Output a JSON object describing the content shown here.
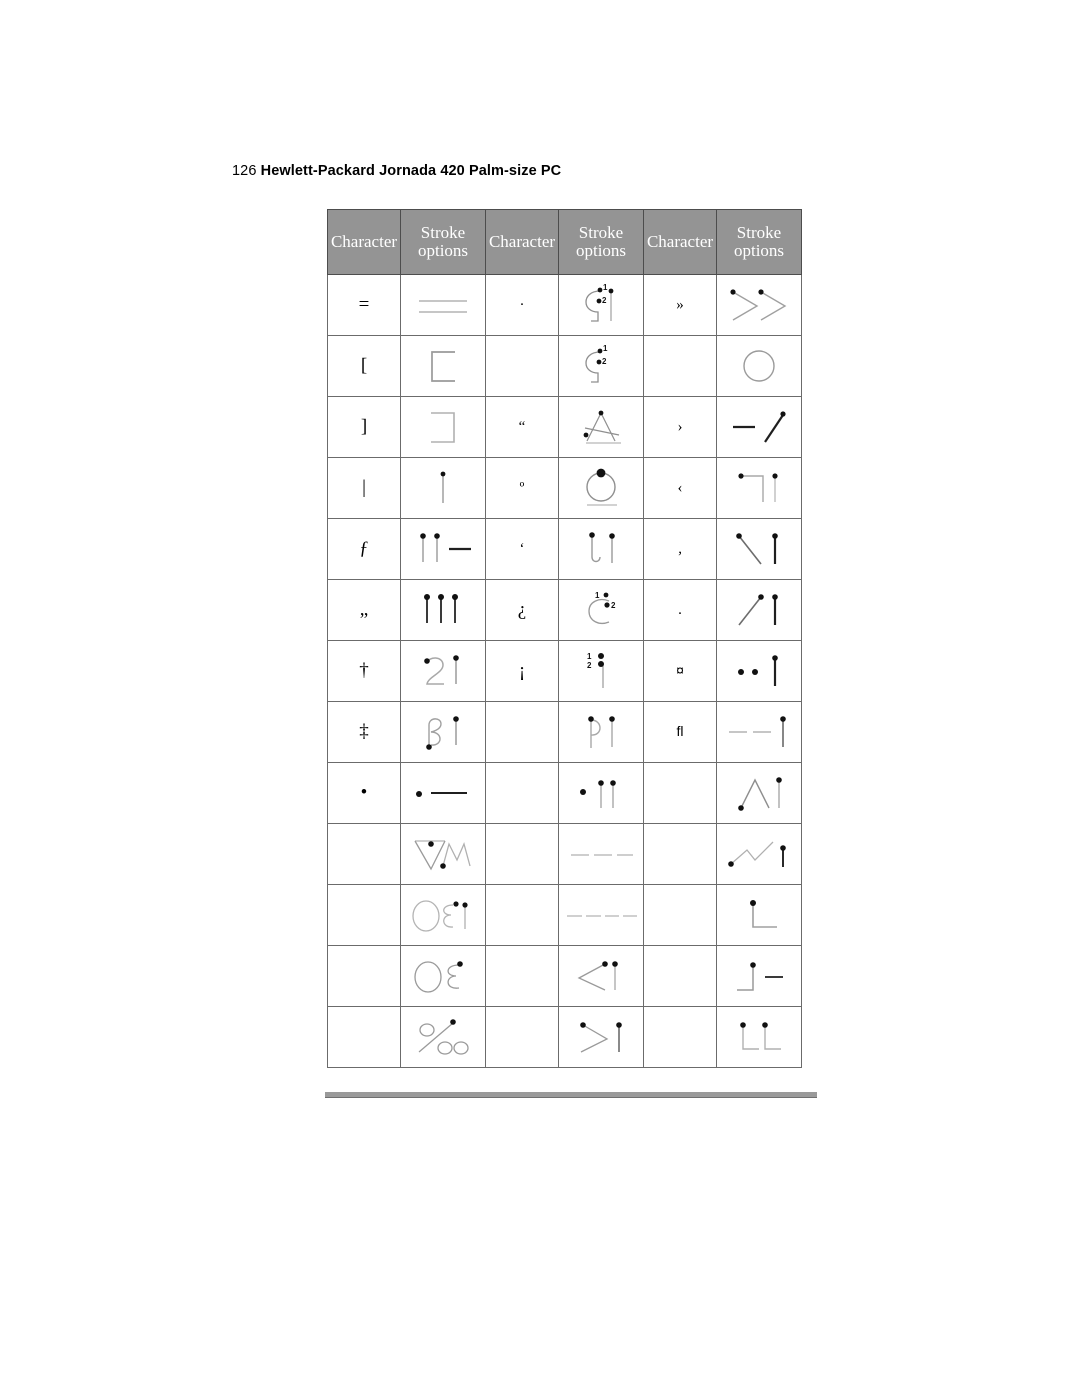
{
  "page": {
    "folio": "126",
    "title": "Hewlett-Packard Jornada 420 Palm-size PC"
  },
  "table": {
    "headers": {
      "character": "Character",
      "stroke_options": "Stroke options"
    },
    "header_cells": [
      "Character",
      "Stroke options",
      "Character",
      "Stroke options",
      "Character",
      "Stroke options"
    ],
    "rows": [
      {
        "c1": "=",
        "c2": "·",
        "c3": "»"
      },
      {
        "c1": "[",
        "c2": "",
        "c3": ""
      },
      {
        "c1": "]",
        "c2": "“",
        "c3": "›"
      },
      {
        "c1": "|",
        "c2": "º",
        "c3": "‹"
      },
      {
        "c1": "ƒ",
        "c2": "‘",
        "c3": "‚"
      },
      {
        "c1": "„",
        "c2": "¿",
        "c3": "."
      },
      {
        "c1": "†",
        "c2": "¡",
        "c3": "¤"
      },
      {
        "c1": "‡",
        "c2": "",
        "c3": "fl"
      },
      {
        "c1": "•",
        "c2": "",
        "c3": ""
      },
      {
        "c1": "",
        "c2": "",
        "c3": ""
      },
      {
        "c1": "",
        "c2": "",
        "c3": ""
      },
      {
        "c1": "",
        "c2": "",
        "c3": ""
      },
      {
        "c1": "",
        "c2": "",
        "c3": ""
      }
    ],
    "stroke_labels": {
      "r1c1": "two-horizontal-lines",
      "r1c2": "numbered-c-hook-and-bar",
      "r1c3": "double-chevron-right",
      "r2c1": "left-bracket-corner",
      "r2c2": "numbered-c-hook",
      "r2c3": "circle",
      "r3c1": "right-bracket-corner",
      "r3c2": "crossed-a",
      "r3c3": "dash-and-slash",
      "r4c1": "vertical-bar",
      "r4c2": "filled-dot-circle",
      "r4c3": "corner-and-bar",
      "r5c1": "two-bars-and-dash",
      "r5c2": "hook-and-bar",
      "r5c3": "backslash-and-bar",
      "r6c1": "three-bars",
      "r6c2": "numbered-reverse-c",
      "r6c3": "slash-and-bar",
      "r7c1": "digit-two-and-bar",
      "r7c2": "numbered-double-dot-bar",
      "r7c3": "two-dots-and-bar",
      "r8c1": "beta-and-bar",
      "r8c2": "p-and-bar",
      "r8c3": "two-dashes-and-bar",
      "r9c1": "dot-and-dash",
      "r9c2": "dot-and-two-bars",
      "r9c3": "caret-and-bar",
      "r10c2": "tm-gesture",
      "r10c4": "three-dashes",
      "r10c6": "zigzag-and-bar",
      "r11c2": "oe-and-bar",
      "r11c4": "four-dashes",
      "r11c6": "l-corner",
      "r12c2": "oe-gesture",
      "r12c4": "left-arrow-triangle",
      "r12c6": "corner-and-dash",
      "r13c2": "per-mille-gesture",
      "r13c4": "right-arrow-and-bar",
      "r13c6": "two-l-corners"
    }
  },
  "colors": {
    "header_background": "#949494",
    "header_text": "#ffffff",
    "grid_line": "#6b6b6b",
    "stroke_dark": "#1a1a1a",
    "stroke_light": "#a8a8a8",
    "footer_rule": "#9a9a9a"
  }
}
